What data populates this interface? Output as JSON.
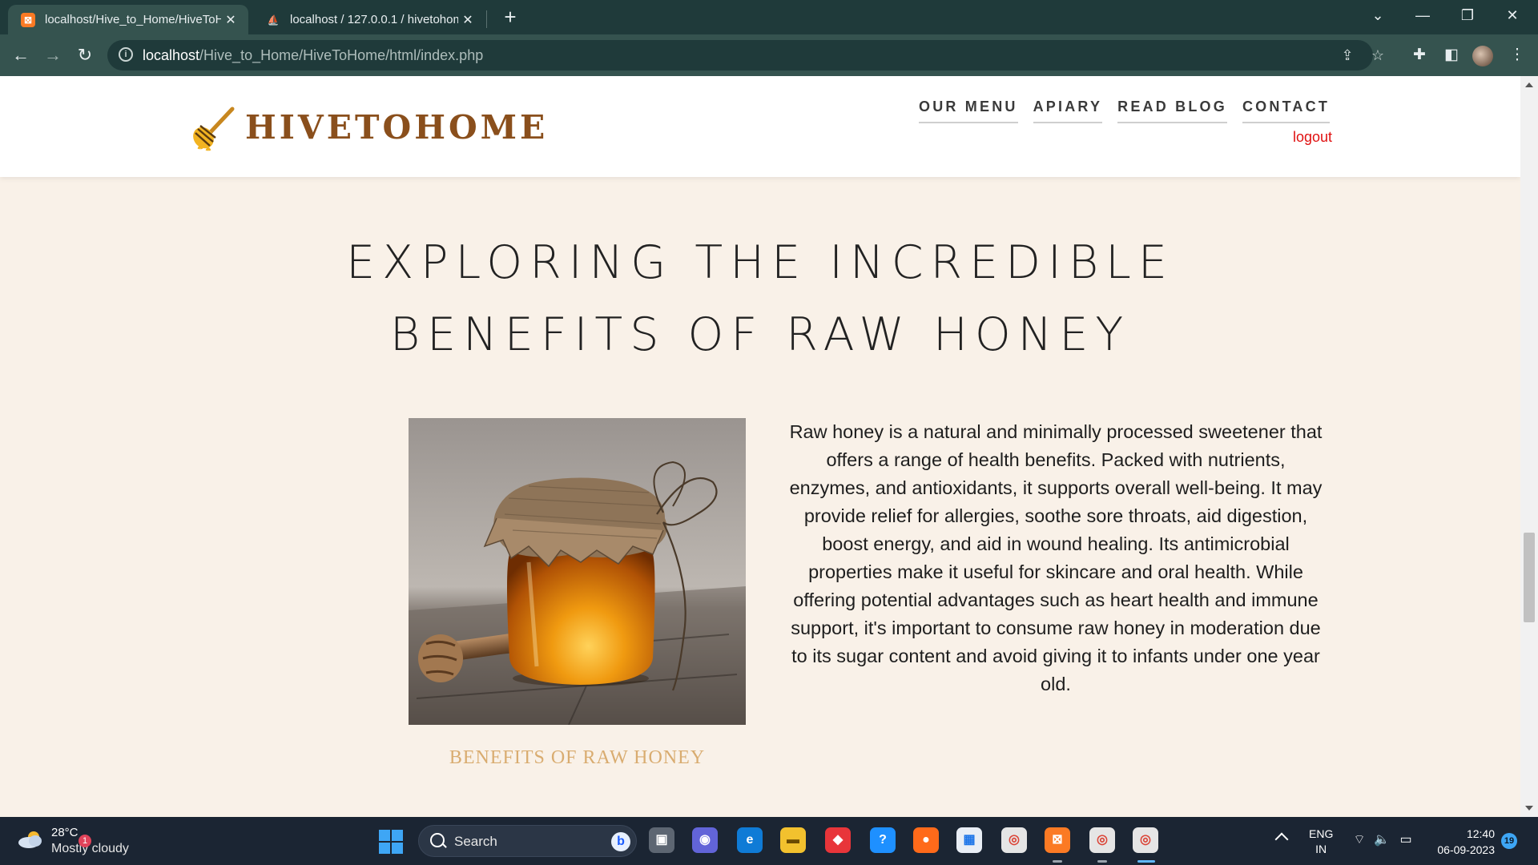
{
  "browser": {
    "tabs": [
      {
        "title": "localhost/Hive_to_Home/HiveToH",
        "favicon": "xampp-icon",
        "active": true
      },
      {
        "title": "localhost / 127.0.0.1 / hivetohom",
        "favicon": "phpmyadmin-icon",
        "active": false
      }
    ],
    "url_host": "localhost",
    "url_path": "/Hive_to_Home/HiveToHome/html/index.php"
  },
  "site": {
    "logo_text": "HIVETOHOME",
    "nav": [
      {
        "label": "OUR MENU"
      },
      {
        "label": "APIARY"
      },
      {
        "label": "READ BLOG"
      },
      {
        "label": "CONTACT"
      }
    ],
    "logout_label": "logout"
  },
  "article": {
    "title": "EXPLORING THE INCREDIBLE BENEFITS OF RAW HONEY",
    "image_caption": "BENEFITS OF RAW HONEY",
    "body": "Raw honey is a natural and minimally processed sweetener that offers a range of health benefits. Packed with nutrients, enzymes, and antioxidants, it supports overall well-being. It may provide relief for allergies, soothe sore throats, aid digestion, boost energy, and aid in wound healing. Its antimicrobial properties make it useful for skincare and oral health. While offering potential advantages such as heart health and immune support, it's important to consume raw honey in moderation due to its sugar content and avoid giving it to infants under one year old."
  },
  "taskbar": {
    "weather_temp": "28°C",
    "weather_desc": "Mostly cloudy",
    "weather_badge": "1",
    "search_label": "Search",
    "lang_line1": "ENG",
    "lang_line2": "IN",
    "time": "12:40",
    "date": "06-09-2023",
    "notification_count": "19"
  },
  "colors": {
    "tab_bar": "#1f3a3a",
    "toolbar": "#35534f",
    "page_bg": "#f9f1e8",
    "logo": "#8a4f1c",
    "caption": "#d9ac70",
    "logout": "#e01010",
    "taskbar": "#1b2533"
  }
}
